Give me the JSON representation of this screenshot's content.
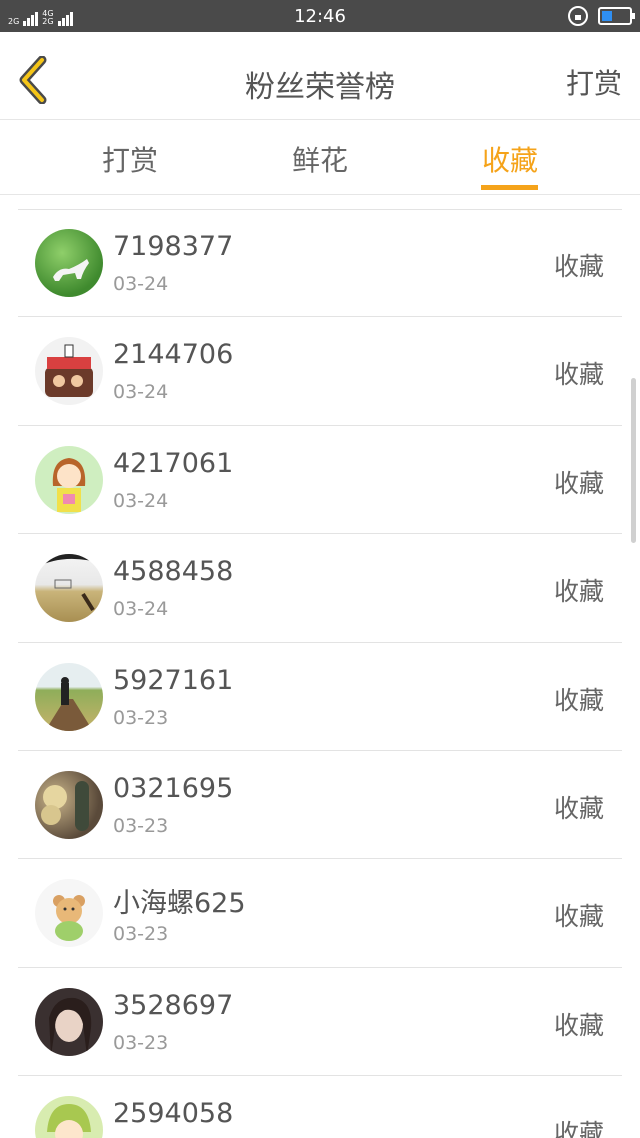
{
  "status_bar": {
    "network_left": "2G",
    "network_mid_top": "4G",
    "network_mid_bottom": "2G",
    "time": "12:46"
  },
  "header": {
    "title": "粉丝荣誉榜",
    "action_label": "打赏"
  },
  "tabs": [
    {
      "label": "打赏",
      "selected": false
    },
    {
      "label": "鲜花",
      "selected": false
    },
    {
      "label": "收藏",
      "selected": true
    }
  ],
  "accent_color": "#f5a31a",
  "items": [
    {
      "name": "7198377",
      "date": "03-24",
      "action": "收藏",
      "avatar": "green-cat-avatar"
    },
    {
      "name": "2144706",
      "date": "03-24",
      "action": "收藏",
      "avatar": "cake-avatar"
    },
    {
      "name": "4217061",
      "date": "03-24",
      "action": "收藏",
      "avatar": "cartoon-girl-avatar"
    },
    {
      "name": "4588458",
      "date": "03-24",
      "action": "收藏",
      "avatar": "field-avatar"
    },
    {
      "name": "5927161",
      "date": "03-23",
      "action": "收藏",
      "avatar": "boardwalk-avatar"
    },
    {
      "name": "0321695",
      "date": "03-23",
      "action": "收藏",
      "avatar": "cactus-avatar"
    },
    {
      "name": "小海螺625",
      "date": "03-23",
      "action": "收藏",
      "avatar": "bear-avatar"
    },
    {
      "name": "3528697",
      "date": "03-23",
      "action": "收藏",
      "avatar": "portrait-avatar"
    },
    {
      "name": "2594058",
      "date": "",
      "action": "收藏",
      "avatar": "anime-avatar"
    }
  ]
}
